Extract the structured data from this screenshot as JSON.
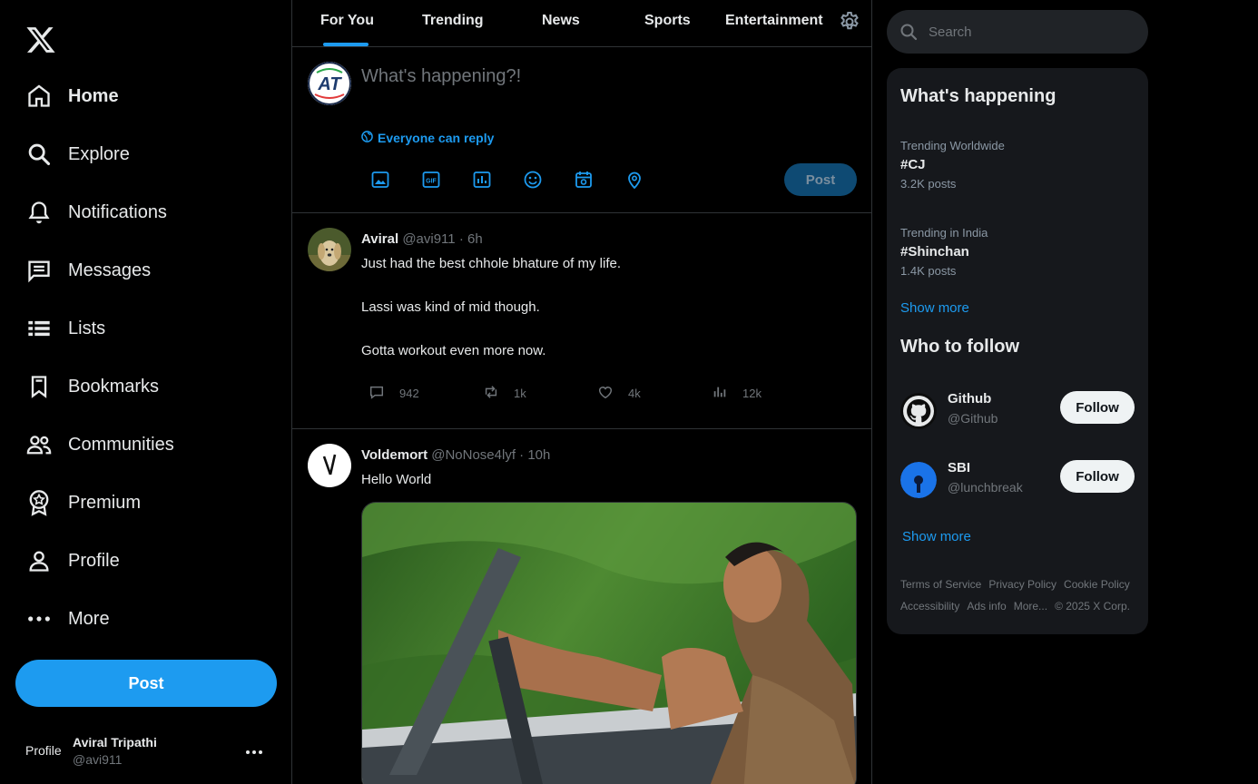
{
  "nav": {
    "items": [
      {
        "label": "Home",
        "icon": "home-icon"
      },
      {
        "label": "Explore",
        "icon": "search-icon"
      },
      {
        "label": "Notifications",
        "icon": "bell-icon"
      },
      {
        "label": "Messages",
        "icon": "message-icon"
      },
      {
        "label": "Lists",
        "icon": "list-icon"
      },
      {
        "label": "Bookmarks",
        "icon": "bookmark-icon"
      },
      {
        "label": "Communities",
        "icon": "people-icon"
      },
      {
        "label": "Premium",
        "icon": "premium-icon"
      },
      {
        "label": "Profile",
        "icon": "person-icon"
      },
      {
        "label": "More",
        "icon": "more-icon"
      }
    ],
    "post_label": "Post"
  },
  "account": {
    "avatar_alt": "Profile",
    "name": "Aviral Tripathi",
    "handle": "@avi911"
  },
  "tabs": [
    "For You",
    "Trending",
    "News",
    "Sports",
    "Entertainment"
  ],
  "composer": {
    "placeholder": "What's happening?!",
    "reply_setting": "Everyone can reply",
    "post_label": "Post",
    "avatar_initials": "AT"
  },
  "tweets": [
    {
      "name": "Aviral",
      "handle": "@avi911",
      "dot": "·",
      "time": "6h",
      "lines": [
        "Just had the best chhole bhature of my life.",
        "Lassi was kind of mid though.",
        "Gotta workout even more now."
      ],
      "replies": "942",
      "reposts": "1k",
      "likes": "4k",
      "views": "12k"
    },
    {
      "name": "Voldemort",
      "handle": "@NoNose4lyf",
      "dot": "·",
      "time": "10h",
      "text": "Hello World"
    }
  ],
  "search": {
    "placeholder": "Search"
  },
  "whats_happening": {
    "title": "What's happening",
    "trends": [
      {
        "context": "Trending Worldwide",
        "tag": "#CJ",
        "count": "3.2K posts"
      },
      {
        "context": "Trending in India",
        "tag": "#Shinchan",
        "count": "1.4K posts"
      }
    ],
    "show_more": "Show more"
  },
  "who_to_follow": {
    "title": "Who to follow",
    "accounts": [
      {
        "name": "Github",
        "handle": "@Github",
        "button": "Follow"
      },
      {
        "name": "SBI",
        "handle": "@lunchbreak",
        "button": "Follow"
      }
    ],
    "show_more": "Show more"
  },
  "footer": {
    "links": [
      "Terms of Service",
      "Privacy Policy",
      "Cookie Policy",
      "Accessibility",
      "Ads info",
      "More...",
      "© 2025 X Corp."
    ]
  },
  "colors": {
    "accent": "#1d9bf0",
    "background": "#000000",
    "panel": "#16181c"
  }
}
